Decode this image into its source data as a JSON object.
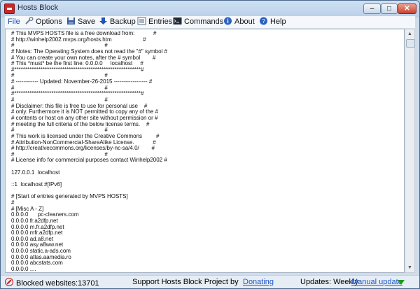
{
  "window": {
    "title": "Hosts Block"
  },
  "menu": {
    "file": "File",
    "options": "Options",
    "save": "Save",
    "backup": "Backup",
    "entries": "Entries",
    "commands": "Commands",
    "about": "About",
    "help": "Help"
  },
  "editor": {
    "lines": [
      "# This MVPS HOSTS file is a free download from:            #",
      "# http://winhelp2002.mvps.org/hosts.htm                    #",
      "#                                                          #",
      "# Notes: The Operating System does not read the \"#\" symbol #",
      "# You can create your own notes, after the # symbol        #",
      "# This *must* be the first line: 0.0.0.0     localhost     #",
      "#**********************************************************#",
      "#                                                          #",
      "# ------------ Updated: November-26-2015 ------------------ #",
      "#                                                          #",
      "#**********************************************************#",
      "#                                                          #",
      "# Disclaimer: this file is free to use for personal use    #",
      "# only. Furthermore it is NOT permitted to copy any of the #",
      "# contents or host on any other site without permission or #",
      "# meeting the full criteria of the below license terms.    #",
      "#                                                          #",
      "# This work is licensed under the Creative Commons         #",
      "# Attribution-NonCommercial-ShareAlike License.            #",
      "# http://creativecommons.org/licenses/by-nc-sa/4.0/        #",
      "#                                                          #",
      "# License info for commercial purposes contact Winhelp2002 #",
      "",
      "127.0.0.1  localhost",
      "",
      "::1  localhost #[IPv6]",
      "",
      "# [Start of entries generated by MVPS HOSTS]",
      "#",
      "# [Misc A - Z]",
      "0.0.0.0      pc-cleaners.com",
      "0.0.0.0 fr.a2dfp.net",
      "0.0.0.0 m.fr.a2dfp.net",
      "0.0.0.0 mfr.a2dfp.net",
      "0.0.0.0 ad.a8.net",
      "0.0.0.0 asy.a8ww.net",
      "0.0.0.0 static.a-ads.com",
      "0.0.0.0 atlas.aamedia.ro",
      "0.0.0.0 abcstats.com",
      "0.0.0.0 ...."
    ]
  },
  "status": {
    "blocked": "Blocked websites:13701",
    "support": "Support Hosts Block Project by",
    "donating": "Donating",
    "updates": "Updates: Weekly",
    "manual_update": "Manual update"
  }
}
